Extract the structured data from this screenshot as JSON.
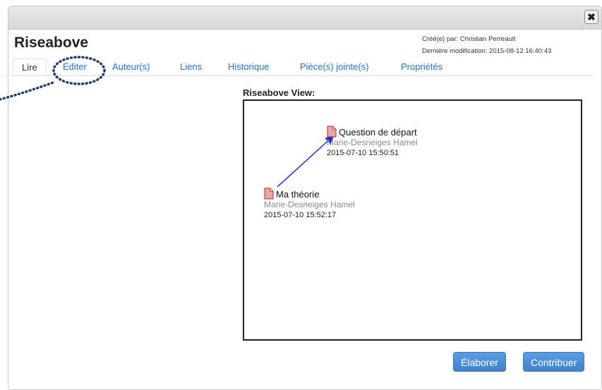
{
  "note": {
    "title": "Riseabove",
    "created_by": "Créé(e) par: Christian Perreault",
    "last_modified": "Dernière modification: 2015-08-12 16:40:43"
  },
  "window": {
    "close_symbol": "✖"
  },
  "tabs": [
    {
      "label": "Lire",
      "active": true
    },
    {
      "label": "Éditer",
      "active": false
    },
    {
      "label": "Auteur(s)",
      "active": false
    },
    {
      "label": "Liens",
      "active": false
    },
    {
      "label": "Historique",
      "active": false
    },
    {
      "label": "Pièce(s) jointe(s)",
      "active": false
    },
    {
      "label": "Propriétés",
      "active": false
    }
  ],
  "view": {
    "label": "Riseabove View:",
    "notes": [
      {
        "title": "Question de départ",
        "author": "Marie-Desneiges Hamel",
        "date": "2015-07-10 15:50:51",
        "icon": "document-icon"
      },
      {
        "title": "Ma théorie",
        "author": "Marie-Desneiges Hamel",
        "date": "2015-07-10 15:52:17",
        "icon": "document-icon"
      }
    ],
    "link_color": "#2222ee"
  },
  "buttons": {
    "elaborate": "Élaborer",
    "contribute": "Contribuer"
  },
  "colors": {
    "link": "#2a6fc3",
    "button": "#4a8fd8",
    "annotation": "#1f3f73"
  }
}
